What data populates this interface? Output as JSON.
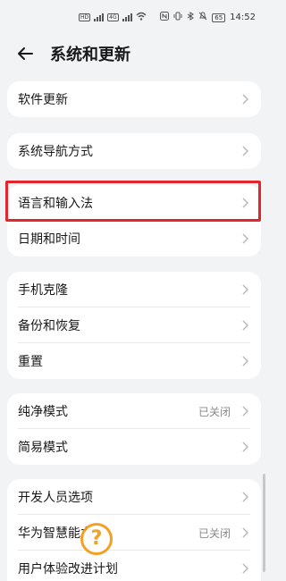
{
  "status_bar": {
    "time": "14:52",
    "battery": "65",
    "network_left": "4G",
    "network_right": "4G"
  },
  "header": {
    "title": "系统和更新",
    "back_icon": "arrow-left-icon"
  },
  "groups": [
    {
      "items": [
        {
          "label": "软件更新"
        }
      ]
    },
    {
      "items": [
        {
          "label": "系统导航方式"
        }
      ]
    },
    {
      "items": [
        {
          "label": "语言和输入法"
        },
        {
          "label": "日期和时间"
        }
      ]
    },
    {
      "items": [
        {
          "label": "手机克隆"
        },
        {
          "label": "备份和恢复"
        },
        {
          "label": "重置"
        }
      ]
    },
    {
      "items": [
        {
          "label": "纯净模式",
          "value": "已关闭"
        },
        {
          "label": "简易模式"
        }
      ]
    },
    {
      "items": [
        {
          "label": "开发人员选项"
        },
        {
          "label": "华为智慧能力",
          "value": "已关闭"
        },
        {
          "label": "用户体验改进计划"
        }
      ]
    }
  ],
  "overlay": {
    "help_glyph": "?",
    "highlight_color": "#e5252c",
    "help_color": "#f39b1c"
  }
}
